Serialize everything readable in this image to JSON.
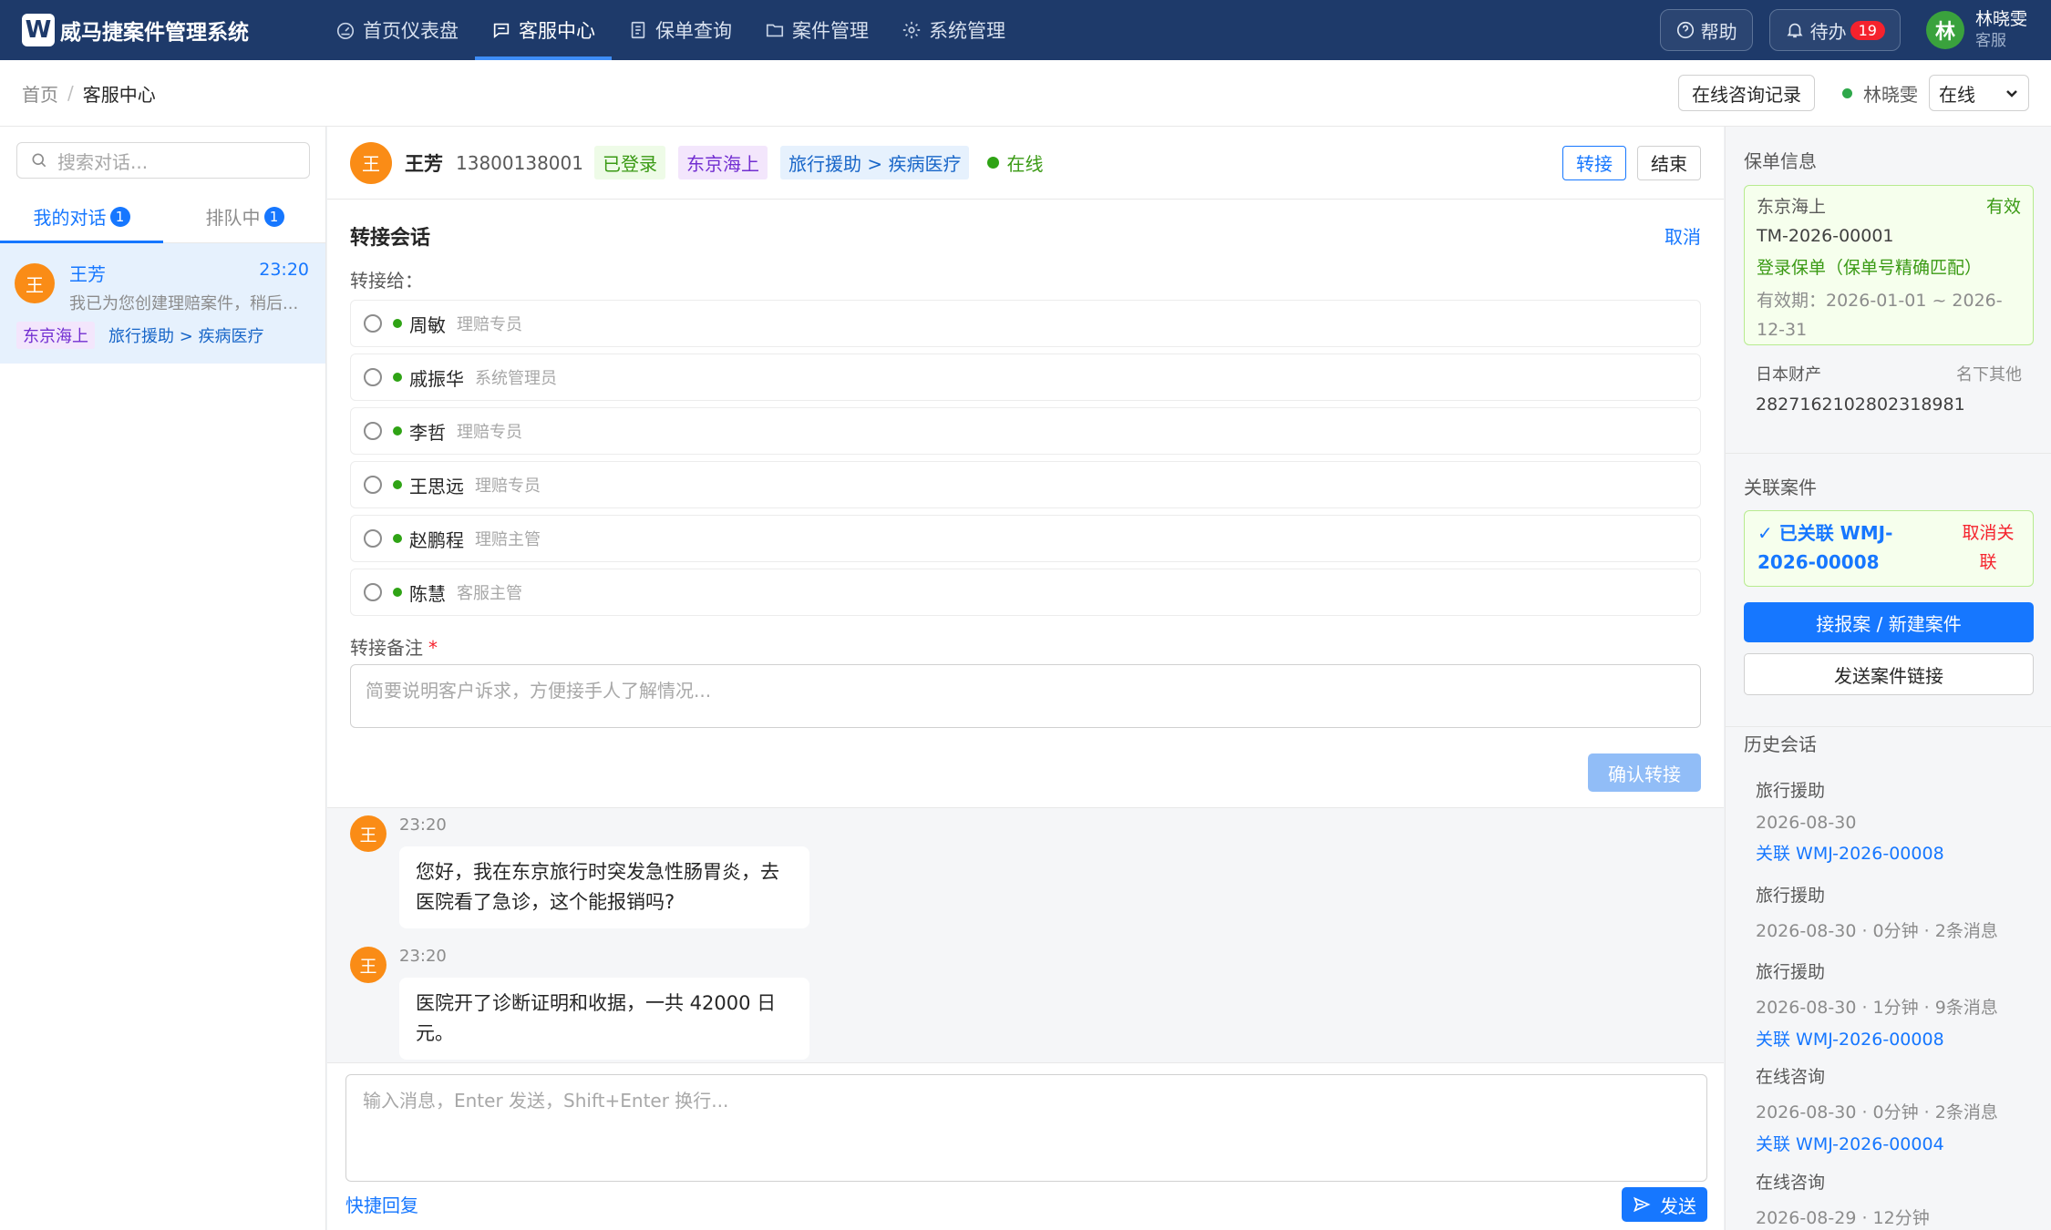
{
  "app": {
    "logo_letter": "W",
    "title": "威马捷案件管理系统",
    "nav": [
      {
        "label": "首页仪表盘",
        "icon": "dashboard-icon"
      },
      {
        "label": "客服中心",
        "icon": "chat-icon",
        "active": true
      },
      {
        "label": "保单查询",
        "icon": "document-icon"
      },
      {
        "label": "案件管理",
        "icon": "folder-icon"
      },
      {
        "label": "系统管理",
        "icon": "gear-icon"
      }
    ],
    "help_label": "帮助",
    "todo_label": "待办",
    "todo_count": "19",
    "user": {
      "initial": "林",
      "name": "林晓雯",
      "role": "客服"
    }
  },
  "breadcrumb": {
    "home": "首页",
    "sep": "/",
    "current": "客服中心"
  },
  "toolbar": {
    "records_label": "在线咨询记录",
    "agent_name": "林晓雯",
    "status_value": "在线"
  },
  "left": {
    "search_placeholder": "搜索对话...",
    "tabs": [
      {
        "label": "我的对话",
        "count": "1"
      },
      {
        "label": "排队中",
        "count": "1"
      }
    ],
    "conversations": [
      {
        "initial": "王",
        "name": "王芳",
        "time": "23:20",
        "snippet": "我已为您创建理赔案件，稍后...",
        "tags": [
          "东京海上",
          "旅行援助 > 疾病医疗"
        ]
      }
    ]
  },
  "chat": {
    "customer": {
      "initial": "王",
      "name": "王芳",
      "phone": "13800138001",
      "login_tag": "已登录",
      "insurer_tag": "东京海上",
      "category_tag": "旅行援助 > 疾病医疗",
      "status": "在线"
    },
    "transfer_btn": "转接",
    "end_btn": "结束",
    "transfer": {
      "title": "转接会话",
      "cancel": "取消",
      "to_label": "转接给：",
      "agents": [
        {
          "name": "周敏",
          "role": "理赔专员"
        },
        {
          "name": "戚振华",
          "role": "系统管理员"
        },
        {
          "name": "李哲",
          "role": "理赔专员"
        },
        {
          "name": "王思远",
          "role": "理赔专员"
        },
        {
          "name": "赵鹏程",
          "role": "理赔主管"
        },
        {
          "name": "陈慧",
          "role": "客服主管"
        }
      ],
      "note_label": "转接备注",
      "note_required": "*",
      "note_placeholder": "简要说明客户诉求，方便接手人了解情况...",
      "confirm": "确认转接"
    },
    "messages": [
      {
        "initial": "王",
        "time": "23:20",
        "text": "您好，我在东京旅行时突发急性肠胃炎，去医院看了急诊，这个能报销吗?"
      },
      {
        "initial": "王",
        "time": "23:20",
        "text": "医院开了诊断证明和收据，一共 42000 日元。"
      }
    ],
    "composer_placeholder": "输入消息，Enter 发送，Shift+Enter 换行...",
    "quick_reply": "快捷回复",
    "send": "发送"
  },
  "right": {
    "policy_title": "保单信息",
    "policy": {
      "insurer": "东京海上",
      "status": "有效",
      "number": "TM-2026-00001",
      "match": "登录保单（保单号精确匹配）",
      "validity": "有效期：2026-01-01 ~ 2026-12-31"
    },
    "policy2": {
      "insurer": "日本财产",
      "note": "名下其他",
      "number": "2827162102802318981"
    },
    "case_title": "关联案件",
    "case": {
      "linked": "✓ 已关联 WMJ-2026-00008",
      "unlink": "取消关联"
    },
    "new_case_btn": "接报案 / 新建案件",
    "send_link_btn": "发送案件链接",
    "history_title": "历史会话",
    "history": [
      {
        "type": "旅行援助",
        "meta": "2026-08-30",
        "link": "关联 WMJ-2026-00008"
      },
      {
        "type": "旅行援助",
        "meta": "2026-08-30 · 0分钟 · 2条消息",
        "link": ""
      },
      {
        "type": "旅行援助",
        "meta": "2026-08-30 · 1分钟 · 9条消息",
        "link": "关联 WMJ-2026-00008"
      },
      {
        "type": "在线咨询",
        "meta": "2026-08-30 · 0分钟 · 2条消息",
        "link": "关联 WMJ-2026-00004"
      },
      {
        "type": "在线咨询",
        "meta": "2026-08-29 · 12分钟",
        "link": ""
      }
    ]
  }
}
